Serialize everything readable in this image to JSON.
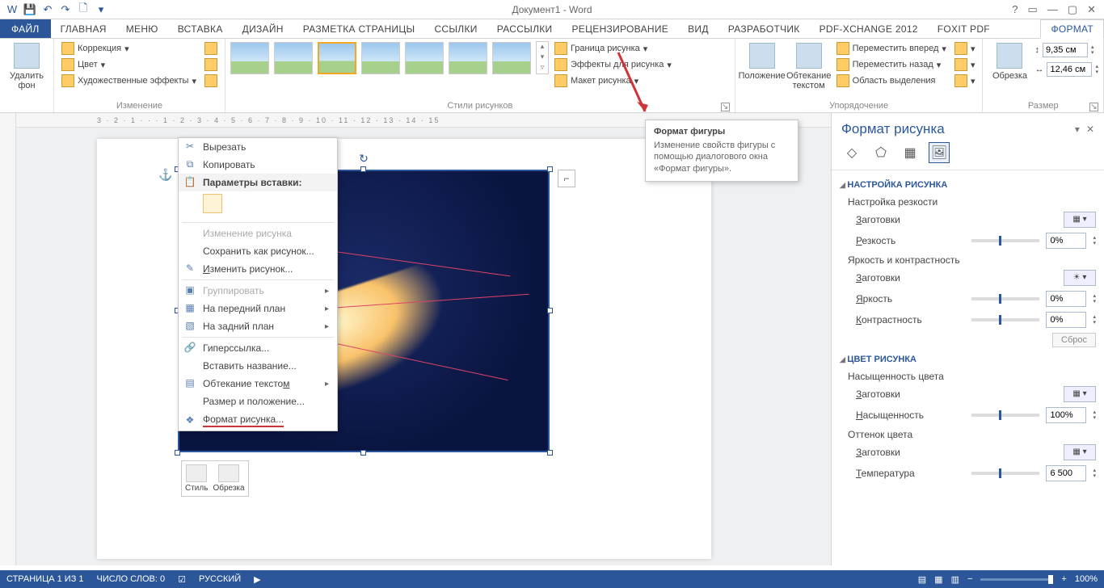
{
  "title": "Документ1 - Word",
  "qat": [
    "save",
    "undo",
    "redo",
    "new",
    "customize"
  ],
  "winbtns": [
    "?",
    "▭",
    "—",
    "▢",
    "✕"
  ],
  "tabs": {
    "file": "ФАЙЛ",
    "items": [
      "ГЛАВНАЯ",
      "Меню",
      "ВСТАВКА",
      "ДИЗАЙН",
      "РАЗМЕТКА СТРАНИЦЫ",
      "ССЫЛКИ",
      "РАССЫЛКИ",
      "РЕЦЕНЗИРОВАНИЕ",
      "ВИД",
      "РАЗРАБОТЧИК",
      "PDF-XChange 2012",
      "Foxit PDF"
    ],
    "format": "ФОРМАТ"
  },
  "ribbon": {
    "g1": {
      "label": "Удалить фон"
    },
    "g2": {
      "label": "Изменение",
      "correction": "Коррекция",
      "color": "Цвет",
      "effects": "Художественные эффекты"
    },
    "g3": {
      "label": "Стили рисунков",
      "border": "Граница рисунка",
      "fx": "Эффекты для рисунка",
      "layout": "Макет рисунка"
    },
    "g4": {
      "label": "Упорядочение",
      "position": "Положение",
      "wrap": "Обтекание текстом",
      "fwd": "Переместить вперед",
      "back": "Переместить назад",
      "selpane": "Область выделения"
    },
    "g5": {
      "label": "Размер",
      "crop": "Обрезка",
      "h": "9,35 см",
      "w": "12,46 см"
    }
  },
  "ruler": [
    "3",
    "2",
    "1",
    "",
    "1",
    "2",
    "3",
    "4",
    "5",
    "6",
    "7",
    "8",
    "9",
    "10",
    "11",
    "12",
    "13",
    "14",
    "15"
  ],
  "ctx": {
    "cut": "Вырезать",
    "copy": "Копировать",
    "paste_hdr": "Параметры вставки:",
    "change": "Изменение рисунка",
    "saveas": "Сохранить как рисунок...",
    "edit": "Изменить рисунок...",
    "group": "Группировать",
    "front": "На передний план",
    "back": "На задний план",
    "link": "Гиперссылка...",
    "caption": "Вставить название...",
    "wrap": "Обтекание текстом",
    "sizepos": "Размер и положение...",
    "format": "Формат рисунка..."
  },
  "minitb": {
    "style": "Стиль",
    "crop": "Обрезка"
  },
  "tooltip": {
    "title": "Формат фигуры",
    "body": "Изменение свойств фигуры с помощью диалогового окна «Формат фигуры»."
  },
  "pane": {
    "title": "Формат рисунка",
    "sect1": "НАСТРОЙКА РИСУНКА",
    "sharp_group": "Настройка резкости",
    "presets": "Заготовки",
    "sharp": "Резкость",
    "sharp_val": "0%",
    "bc_group": "Яркость и контрастность",
    "bright": "Яркость",
    "bright_val": "0%",
    "contrast": "Контрастность",
    "contrast_val": "0%",
    "reset": "Сброс",
    "sect2": "ЦВЕТ РИСУНКА",
    "sat_group": "Насыщенность цвета",
    "sat": "Насыщенность",
    "sat_val": "100%",
    "tone_group": "Оттенок цвета",
    "temp": "Температура",
    "temp_val": "6 500"
  },
  "status": {
    "page": "СТРАНИЦА 1 ИЗ 1",
    "words": "ЧИСЛО СЛОВ: 0",
    "lang": "РУССКИЙ",
    "zoom": "100%"
  }
}
